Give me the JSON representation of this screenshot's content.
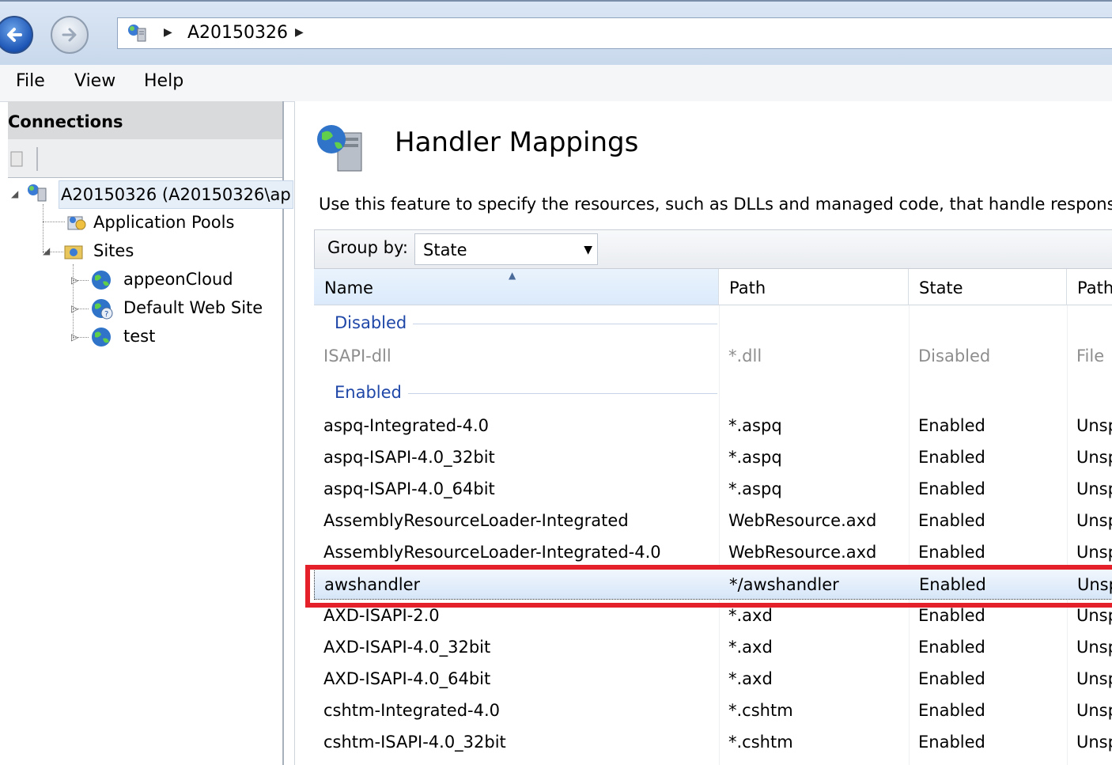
{
  "address_bar": {
    "path": "A20150326",
    "separator_icon": "triangle-right"
  },
  "menu": {
    "file": "File",
    "view": "View",
    "help": "Help"
  },
  "connections": {
    "title": "Connections",
    "tree": {
      "server": "A20150326 (A20150326\\ap",
      "app_pools": "Application Pools",
      "sites": "Sites",
      "site_items": [
        "appeonCloud",
        "Default Web Site",
        "test"
      ]
    }
  },
  "main": {
    "title": "Handler Mappings",
    "description": "Use this feature to specify the resources, such as DLLs and managed code, that handle response",
    "group_by_label": "Group by:",
    "group_by_value": "State",
    "columns": [
      "Name",
      "Path",
      "State",
      "Path"
    ],
    "groups": [
      {
        "label": "Disabled",
        "rows": [
          {
            "name": "ISAPI-dll",
            "path": "*.dll",
            "state": "Disabled",
            "path_type": "File"
          }
        ]
      },
      {
        "label": "Enabled",
        "rows": [
          {
            "name": "aspq-Integrated-4.0",
            "path": "*.aspq",
            "state": "Enabled",
            "path_type": "Unsp"
          },
          {
            "name": "aspq-ISAPI-4.0_32bit",
            "path": "*.aspq",
            "state": "Enabled",
            "path_type": "Unsp"
          },
          {
            "name": "aspq-ISAPI-4.0_64bit",
            "path": "*.aspq",
            "state": "Enabled",
            "path_type": "Unsp"
          },
          {
            "name": "AssemblyResourceLoader-Integrated",
            "path": "WebResource.axd",
            "state": "Enabled",
            "path_type": "Unsp"
          },
          {
            "name": "AssemblyResourceLoader-Integrated-4.0",
            "path": "WebResource.axd",
            "state": "Enabled",
            "path_type": "Unsp"
          },
          {
            "name": "awshandler",
            "path": "*/awshandler",
            "state": "Enabled",
            "path_type": "Unsp"
          },
          {
            "name": "AXD-ISAPI-2.0",
            "path": "*.axd",
            "state": "Enabled",
            "path_type": "Unsp"
          },
          {
            "name": "AXD-ISAPI-4.0_32bit",
            "path": "*.axd",
            "state": "Enabled",
            "path_type": "Unsp"
          },
          {
            "name": "AXD-ISAPI-4.0_64bit",
            "path": "*.axd",
            "state": "Enabled",
            "path_type": "Unsp"
          },
          {
            "name": "cshtm-Integrated-4.0",
            "path": "*.cshtm",
            "state": "Enabled",
            "path_type": "Unsp"
          },
          {
            "name": "cshtm-ISAPI-4.0_32bit",
            "path": "*.cshtm",
            "state": "Enabled",
            "path_type": "Unsp"
          }
        ]
      }
    ]
  },
  "colors": {
    "highlight": "#e4202a",
    "group_text": "#1f47a8",
    "selected_row": "#d6e6f8"
  }
}
